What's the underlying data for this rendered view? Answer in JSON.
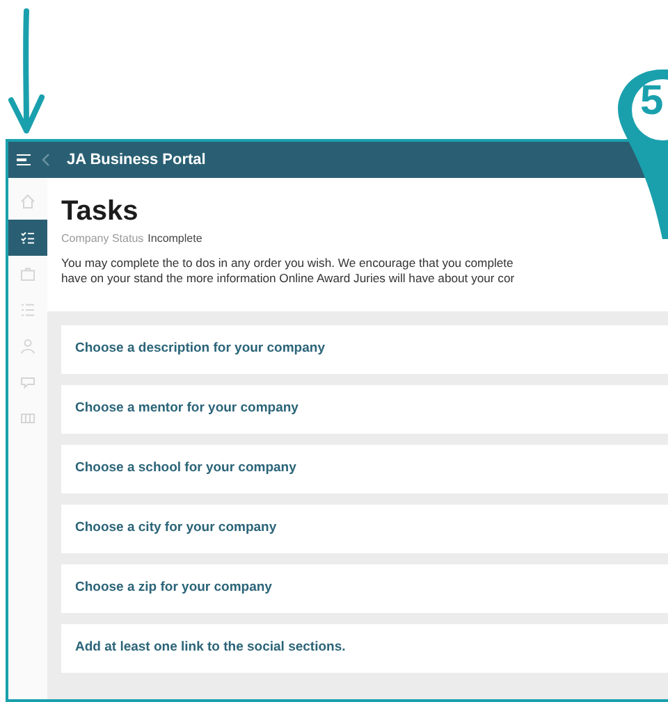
{
  "annotation": {
    "step_badge": "5"
  },
  "header": {
    "title": "JA Business Portal"
  },
  "sidebar": {
    "items": [
      {
        "kind": "home",
        "selected": false
      },
      {
        "kind": "checklist",
        "selected": true
      },
      {
        "kind": "briefcase",
        "selected": false
      },
      {
        "kind": "list",
        "selected": false
      },
      {
        "kind": "person",
        "selected": false
      },
      {
        "kind": "chat",
        "selected": false
      },
      {
        "kind": "grid",
        "selected": false
      }
    ]
  },
  "page": {
    "title": "Tasks",
    "status_label": "Company Status",
    "status_value": "Incomplete",
    "intro_lines": [
      "You may complete the to dos in any order you wish. We encourage that you complete",
      "have on your stand the more information Online Award Juries will have about your cor"
    ]
  },
  "tasks": [
    "Choose a description for your company",
    "Choose a mentor for your company",
    "Choose a school for your company",
    "Choose a city for your company",
    "Choose a zip for your company",
    "Add at least one link to the social sections."
  ]
}
